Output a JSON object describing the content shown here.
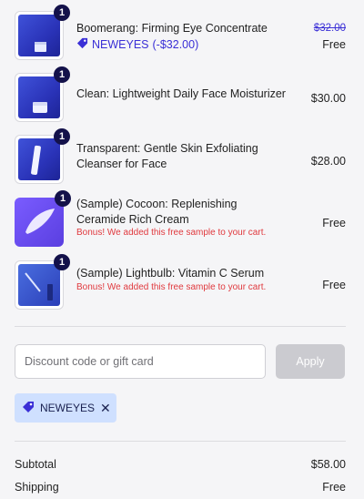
{
  "items": [
    {
      "qty": "1",
      "title": "Boomerang: Firming Eye Concentrate",
      "discount_code": "NEWEYES",
      "discount_amount": "(-$32.00)",
      "original_price": "$32.00",
      "price": "Free"
    },
    {
      "qty": "1",
      "title": "Clean: Lightweight Daily Face Moisturizer",
      "price": "$30.00"
    },
    {
      "qty": "1",
      "title": "Transparent: Gentle Skin Exfoliating Cleanser for Face",
      "price": "$28.00"
    },
    {
      "qty": "1",
      "title": "(Sample) Cocoon: Replenishing Ceramide Rich Cream",
      "bonus": "Bonus! We added this free sample to your cart.",
      "price": "Free"
    },
    {
      "qty": "1",
      "title": "(Sample) Lightbulb: Vitamin C Serum",
      "bonus": "Bonus! We added this free sample to your cart.",
      "price": "Free"
    }
  ],
  "discount": {
    "placeholder": "Discount code or gift card",
    "apply_label": "Apply",
    "applied_code": "NEWEYES"
  },
  "summary": {
    "subtotal_label": "Subtotal",
    "subtotal_value": "$58.00",
    "shipping_label": "Shipping",
    "shipping_value": "Free"
  },
  "colors": {
    "accent": "#3a2fd6",
    "bonus_red": "#e0393e",
    "badge": "#13114a",
    "chip_bg": "#cfe0ff"
  }
}
